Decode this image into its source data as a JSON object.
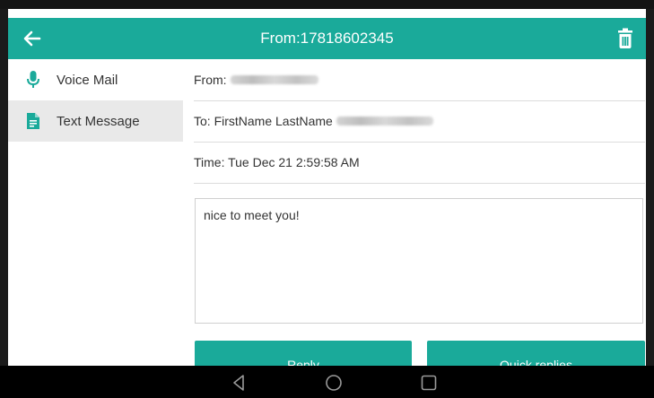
{
  "header": {
    "title": "From:17818602345",
    "back_icon": "arrow-left-icon",
    "delete_icon": "trash-icon",
    "color": "#1aaa9a"
  },
  "sidebar": {
    "items": [
      {
        "label": "Voice Mail",
        "icon": "microphone-icon",
        "active": false
      },
      {
        "label": "Text Message",
        "icon": "document-icon",
        "active": true
      }
    ]
  },
  "message": {
    "from_label": "From:",
    "to_label": "To: FirstName LastName",
    "time_label": "Time: Tue Dec 21 2:59:58 AM",
    "body": "nice to meet you!"
  },
  "actions": {
    "reply_label": "Reply",
    "quick_replies_label": "Quick replies"
  },
  "navbar": {
    "back_icon": "triangle-back-icon",
    "home_icon": "circle-home-icon",
    "recents_icon": "square-recents-icon"
  }
}
